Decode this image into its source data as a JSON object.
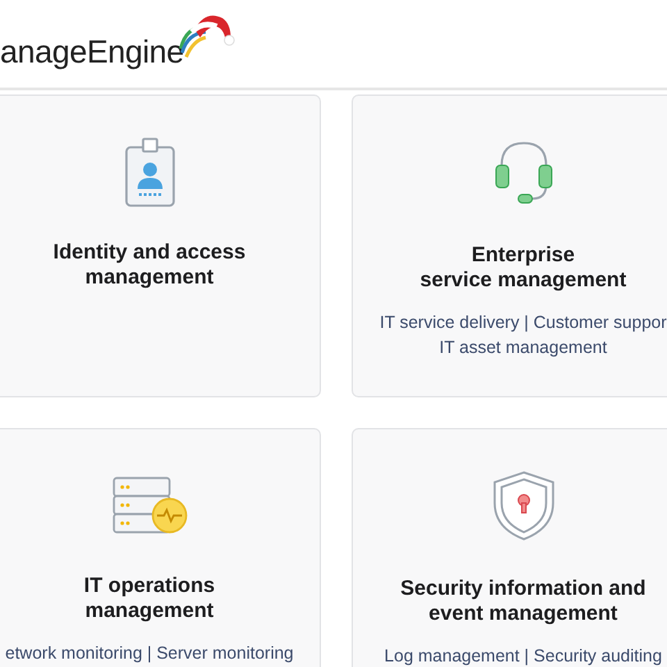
{
  "header": {
    "logo_text": "anageEngine"
  },
  "cards": [
    {
      "kind": "badge",
      "title": [
        "Identity and access",
        "management"
      ]
    },
    {
      "kind": "headset",
      "title": [
        "Enterprise",
        "service management"
      ],
      "links": [
        "IT service delivery | Customer suppor",
        "IT asset management"
      ]
    },
    {
      "kind": "server",
      "title": [
        "IT operations",
        "management"
      ],
      "links": [
        "etwork monitoring | Server monitoring"
      ]
    },
    {
      "kind": "shield",
      "title": [
        "Security information and",
        "event management"
      ],
      "links": [
        "Log management | Security auditing"
      ]
    }
  ]
}
